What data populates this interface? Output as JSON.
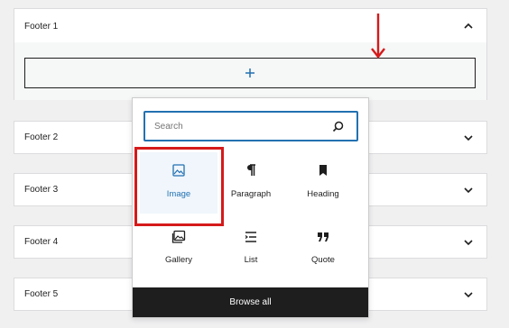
{
  "panels": [
    {
      "title": "Footer 1",
      "expanded": true
    },
    {
      "title": "Footer 2",
      "expanded": false
    },
    {
      "title": "Footer 3",
      "expanded": false
    },
    {
      "title": "Footer 4",
      "expanded": false
    },
    {
      "title": "Footer 5",
      "expanded": false
    }
  ],
  "inserter": {
    "search_placeholder": "Search",
    "blocks": [
      {
        "label": "Image",
        "icon": "image-icon",
        "selected": true
      },
      {
        "label": "Paragraph",
        "icon": "paragraph-icon"
      },
      {
        "label": "Heading",
        "icon": "heading-icon"
      },
      {
        "label": "Gallery",
        "icon": "gallery-icon"
      },
      {
        "label": "List",
        "icon": "list-icon"
      },
      {
        "label": "Quote",
        "icon": "quote-icon"
      }
    ],
    "browse_all_label": "Browse all"
  },
  "colors": {
    "accent": "#2271b1",
    "annotation": "#d51a1a",
    "dark": "#1e1e1e",
    "background": "#f0f0f1"
  }
}
